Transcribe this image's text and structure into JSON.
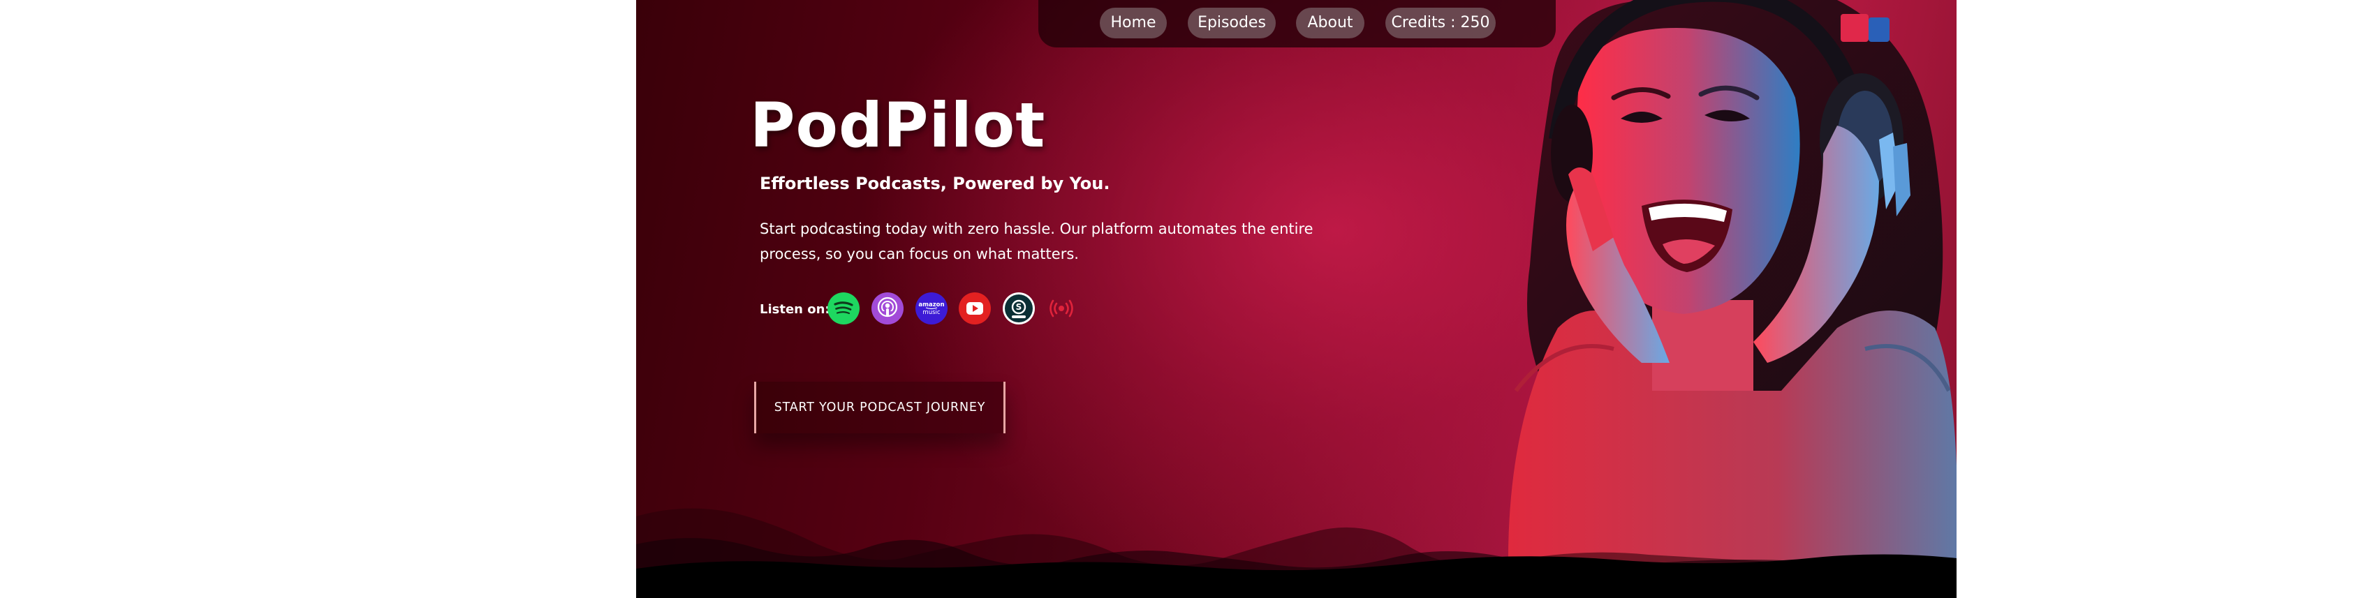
{
  "nav": {
    "home": "Home",
    "episodes": "Episodes",
    "about": "About",
    "credits": "Credits : 250"
  },
  "hero": {
    "brand": "PodPilot",
    "tagline": "Effortless Podcasts, Powered by You.",
    "description": "Start podcasting today with zero hassle. Our platform automates the entire process, so you can focus on what matters.",
    "listen_label": "Listen on:",
    "platforms": [
      {
        "name": "Spotify",
        "icon": "spotify-icon",
        "color": "#1ed760"
      },
      {
        "name": "Apple Podcasts",
        "icon": "apple-podcasts-icon",
        "color": "#a24bd8"
      },
      {
        "name": "Amazon Music",
        "icon": "amazon-music-icon",
        "color": "#3d1bd6"
      },
      {
        "name": "YouTube",
        "icon": "youtube-icon",
        "color": "#e32121"
      },
      {
        "name": "Castbox",
        "icon": "castbox-icon",
        "color": "#0b2f35"
      },
      {
        "name": "Podcast Radio",
        "icon": "radio-broadcast-icon",
        "color": "#d6273b"
      }
    ],
    "amazon_text_1": "amazon",
    "amazon_text_2": "music",
    "cta": "START YOUR PODCAST JOURNEY"
  },
  "colors": {
    "accent": "#b0183f",
    "dark": "#3a0009",
    "cta_border": "#e8a7a5"
  }
}
